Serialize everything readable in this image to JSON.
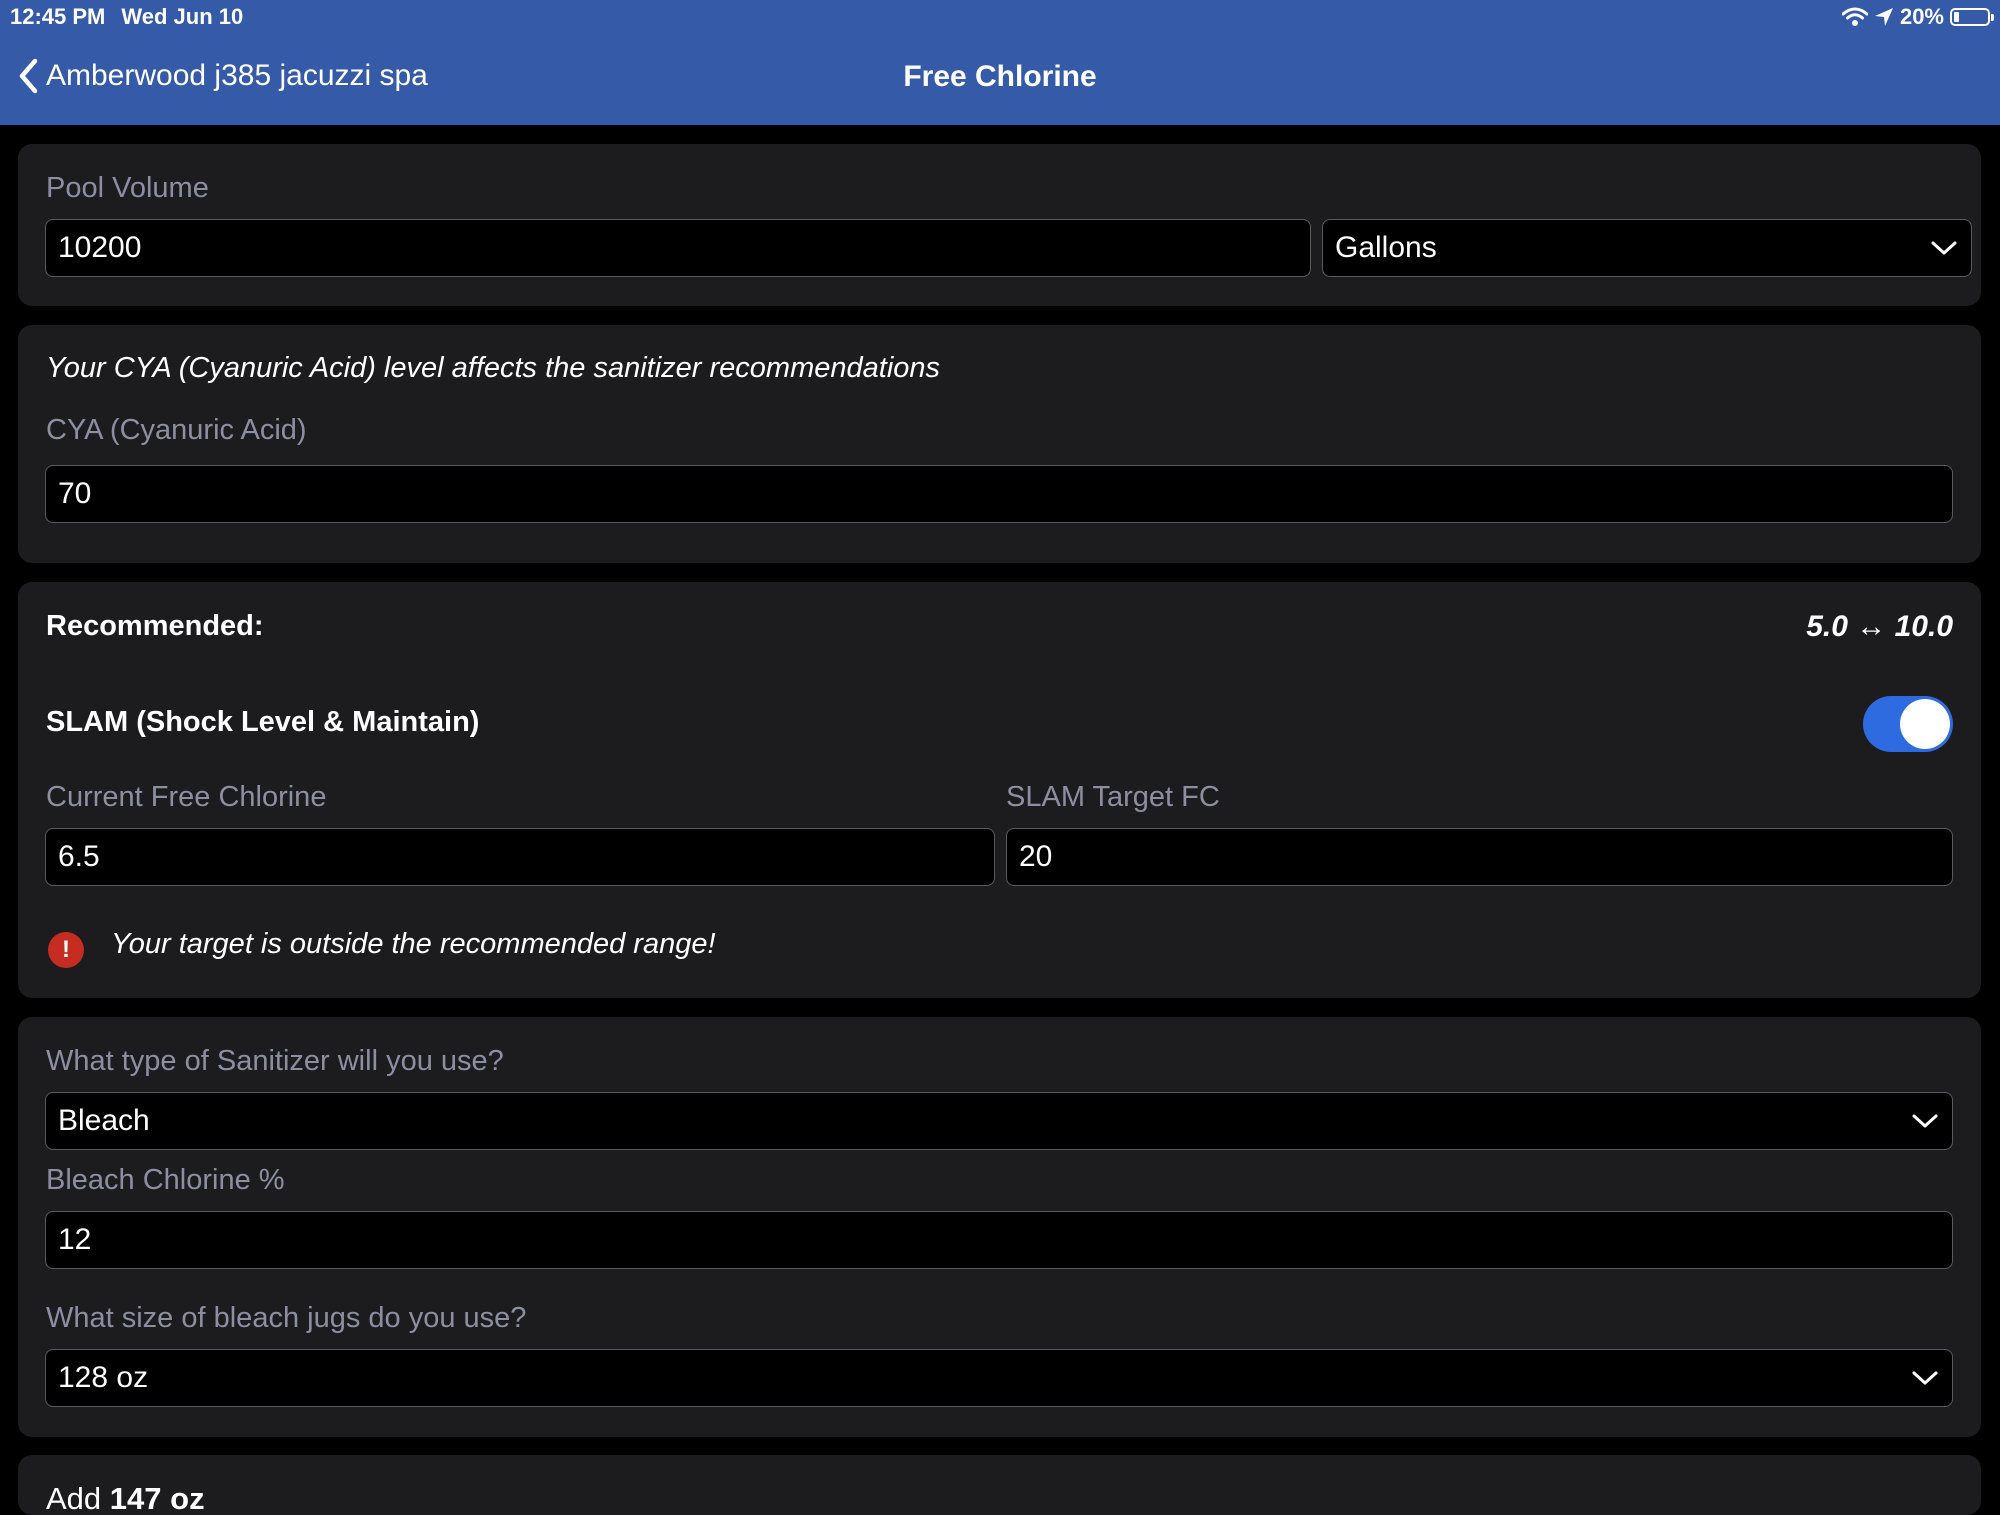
{
  "status_bar": {
    "time": "12:45 PM",
    "date": "Wed Jun 10",
    "battery": "20%"
  },
  "nav": {
    "back_label": "Amberwood j385 jacuzzi spa",
    "title": "Free Chlorine"
  },
  "volume": {
    "label": "Pool Volume",
    "value": "10200",
    "unit": "Gallons"
  },
  "cya": {
    "note": "Your CYA (Cyanuric Acid) level affects the sanitizer recommendations",
    "label": "CYA (Cyanuric Acid)",
    "value": "70"
  },
  "recommend": {
    "label": "Recommended:",
    "range": "5.0 ↔ 10.0",
    "slam_label": "SLAM (Shock Level & Maintain)",
    "slam_on": true,
    "current_label": "Current Free Chlorine",
    "current_value": "6.5",
    "target_label": "SLAM Target FC",
    "target_value": "20",
    "warning": "Your target is outside the recommended range!"
  },
  "sanitizer": {
    "type_label": "What type of Sanitizer will you use?",
    "type_value": "Bleach",
    "percent_label": "Bleach Chlorine %",
    "percent_value": "12",
    "jug_label": "What size of bleach jugs do you use?",
    "jug_value": "128 oz"
  },
  "result": {
    "prefix": "Add",
    "amount": "147 oz"
  },
  "colors": {
    "header": "#355aa7",
    "card": "#1c1c1e",
    "accent": "#2f6be0",
    "warning": "#c62d22"
  }
}
